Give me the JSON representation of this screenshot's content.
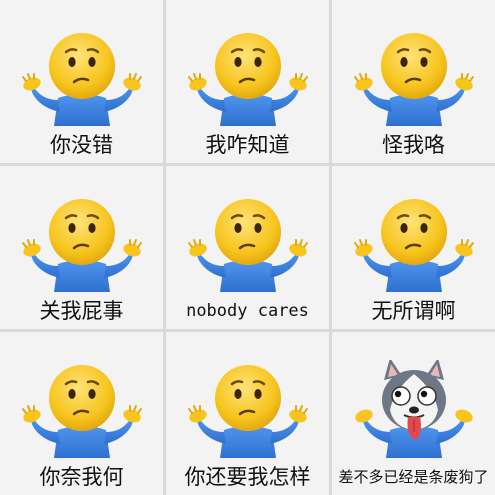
{
  "meme_grid": {
    "cells": [
      {
        "caption": "你没错",
        "character": "shrug-emoji-icon"
      },
      {
        "caption": "我咋知道",
        "character": "shrug-emoji-icon"
      },
      {
        "caption": "怪我咯",
        "character": "shrug-emoji-icon"
      },
      {
        "caption": "关我屁事",
        "character": "shrug-emoji-icon"
      },
      {
        "caption": "nobody cares",
        "character": "shrug-emoji-icon"
      },
      {
        "caption": "无所谓啊",
        "character": "shrug-emoji-icon"
      },
      {
        "caption": "你奈我何",
        "character": "shrug-emoji-icon"
      },
      {
        "caption": "你还要我怎样",
        "character": "shrug-emoji-icon"
      },
      {
        "caption": "差不多已经是条废狗了",
        "character": "husky-shrug-icon"
      }
    ]
  },
  "colors": {
    "face": "#f7c51e",
    "shirt": "#3f86e6",
    "tongue": "#e4484f"
  }
}
